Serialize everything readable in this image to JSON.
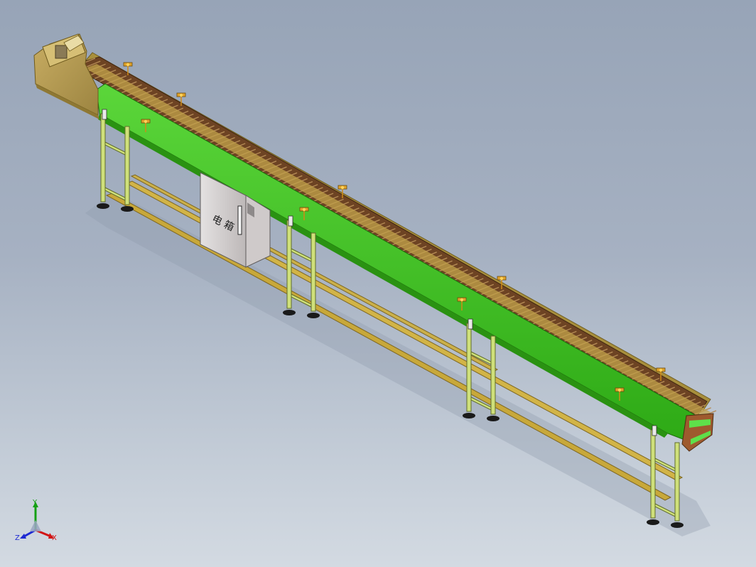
{
  "viewport": {
    "background_top": "#97a4b7",
    "background_bottom": "#d3dae2"
  },
  "model": {
    "frame_color": "#3cc31e",
    "leg_color": "#cfe07a",
    "cabinet_color": "#d8d4d4",
    "cabinet_label": "电 箱"
  },
  "triad": {
    "x_label": "X",
    "y_label": "Y",
    "z_label": "Z",
    "x_color": "#d21414",
    "y_color": "#14a014",
    "z_color": "#1e2ad2"
  }
}
